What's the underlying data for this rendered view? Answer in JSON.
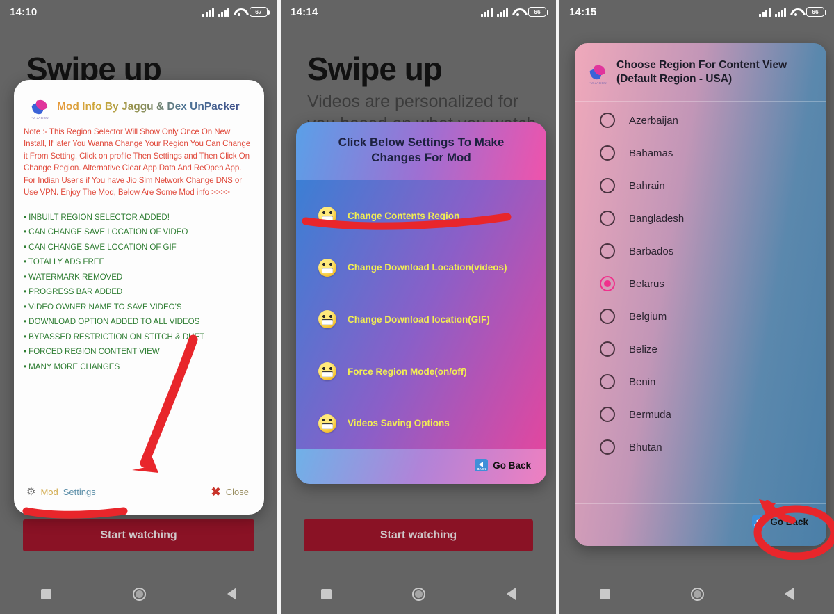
{
  "panels": [
    {
      "statusbar": {
        "time": "14:10",
        "battery": "67"
      },
      "background": {
        "title": "Swipe up",
        "subtitle": "",
        "cta": "Start watching"
      }
    },
    {
      "statusbar": {
        "time": "14:14",
        "battery": "66"
      },
      "background": {
        "title": "Swipe up",
        "subtitle": "Videos are personalized for you based on what you watch, like",
        "cta": "Start watching"
      }
    },
    {
      "statusbar": {
        "time": "14:15",
        "battery": "66"
      },
      "background": {
        "title": "",
        "subtitle": "",
        "cta": ""
      }
    }
  ],
  "mod_info_dialog": {
    "logo_caption": "I'M JAGGU",
    "title": "Mod Info By Jaggu & Dex UnPacker",
    "note": "Note :- This Region Selector Will Show Only Once On New Install, If later You Wanna Change Your Region You Can Change it From Setting, Click on profile Then Settings and Then Click On Change Region. Alternative Clear App Data And ReOpen App. For Indian User's if You have Jio Sim Network Change DNS or Use VPN. Enjoy The Mod, Below Are Some Mod info >>>>",
    "features": [
      "• INBUILT REGION SELECTOR ADDED!",
      "• CAN CHANGE SAVE LOCATION OF VIDEO",
      "• CAN CHANGE SAVE LOCATION OF GIF",
      "• TOTALLY ADS FREE",
      "• WATERMARK REMOVED",
      "• PROGRESS BAR ADDED",
      "• VIDEO OWNER NAME TO SAVE VIDEO'S",
      "• DOWNLOAD OPTION ADDED TO ALL VIDEOS",
      "• BYPASSED RESTRICTION ON STITCH & DUET",
      "• FORCED REGION CONTENT VIEW",
      "• MANY MORE CHANGES"
    ],
    "settings_label_mod": "Mod",
    "settings_label_settings": "Settings",
    "close_label": "Close",
    "gear_icon": "gear-icon",
    "close_icon": "x-icon"
  },
  "mod_settings_dialog": {
    "header": "Click Below Settings To Make Changes For Mod",
    "items": [
      {
        "label": "Change Contents Region",
        "icon": "grinning-emoji"
      },
      {
        "label": "Change Download Location(videos)",
        "icon": "grinning-emoji"
      },
      {
        "label": "Change Download location(GIF)",
        "icon": "grinning-emoji"
      },
      {
        "label": "Force Region Mode(on/off)",
        "icon": "grinning-emoji"
      },
      {
        "label": "Videos Saving Options",
        "icon": "grinning-emoji"
      }
    ],
    "go_back_label": "Go Back",
    "go_back_icon": "back-arrow-icon"
  },
  "region_dialog": {
    "title": "Choose Region For Content View (Default Region - USA)",
    "logo_caption": "I'M JAGGU",
    "countries": [
      {
        "name": "Azerbaijan",
        "selected": false
      },
      {
        "name": "Bahamas",
        "selected": false
      },
      {
        "name": "Bahrain",
        "selected": false
      },
      {
        "name": "Bangladesh",
        "selected": false
      },
      {
        "name": "Barbados",
        "selected": false
      },
      {
        "name": "Belarus",
        "selected": true
      },
      {
        "name": "Belgium",
        "selected": false
      },
      {
        "name": "Belize",
        "selected": false
      },
      {
        "name": "Benin",
        "selected": false
      },
      {
        "name": "Bermuda",
        "selected": false
      },
      {
        "name": "Bhutan",
        "selected": false
      }
    ],
    "go_back_label": "Go Back",
    "go_back_icon": "back-arrow-icon"
  },
  "navbar": {
    "recents_icon": "square-icon",
    "home_icon": "circle-icon",
    "back_icon": "triangle-back-icon"
  },
  "colors": {
    "annotation_red": "#e8262b",
    "selected_radio": "#f0318c",
    "note_red": "#e04a3c",
    "feature_green": "#2e7d32",
    "cta_maroon": "#8a1225"
  }
}
